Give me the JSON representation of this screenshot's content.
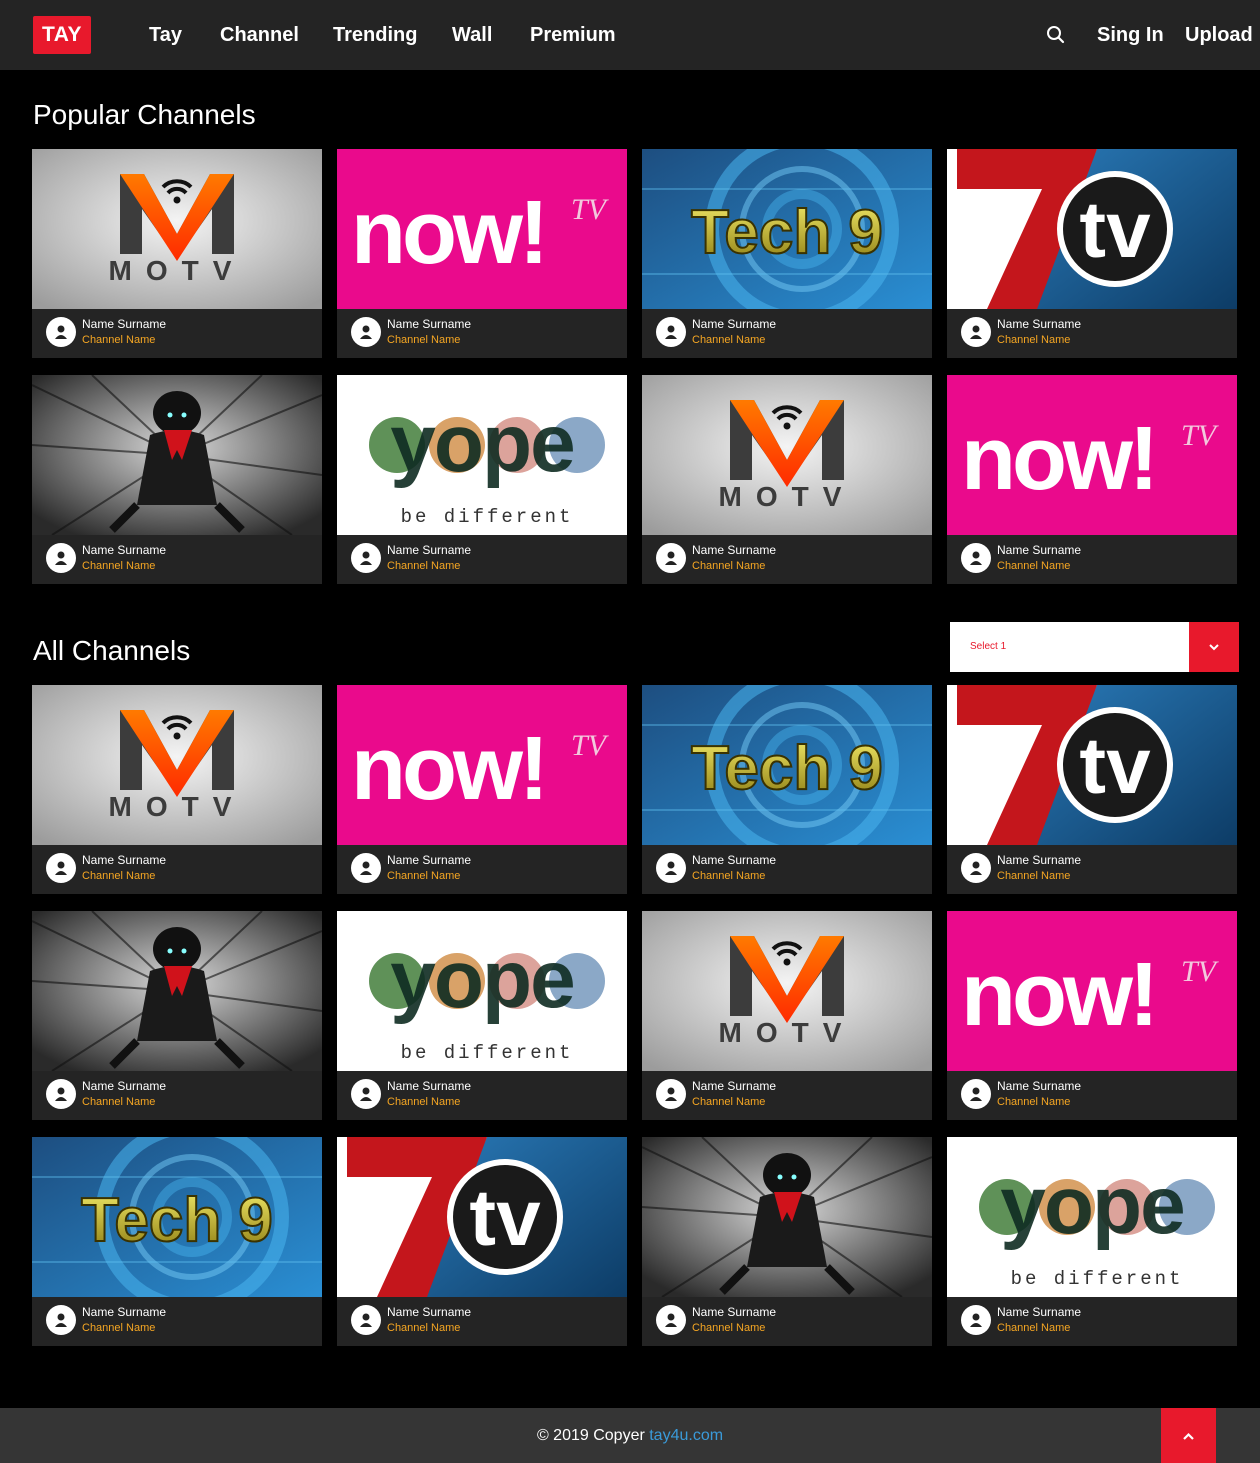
{
  "header": {
    "logo": "TAY",
    "nav": [
      "Tay",
      "Channel",
      "Trending",
      "Wall",
      "Premium"
    ],
    "sign_in": "Sing In",
    "upload": "Upload",
    "search_icon": "search-icon"
  },
  "popular": {
    "title": "Popular Channels",
    "cards": [
      {
        "thumb": "motv",
        "name": "Name Surname",
        "channel": "Channel Name"
      },
      {
        "thumb": "now",
        "name": "Name Surname",
        "channel": "Channel Name"
      },
      {
        "thumb": "tech9",
        "name": "Name Surname",
        "channel": "Channel Name"
      },
      {
        "thumb": "7tv",
        "name": "Name Surname",
        "channel": "Channel Name"
      },
      {
        "thumb": "anime",
        "name": "Name Surname",
        "channel": "Channel Name"
      },
      {
        "thumb": "yope",
        "name": "Name Surname",
        "channel": "Channel Name"
      },
      {
        "thumb": "motv",
        "name": "Name Surname",
        "channel": "Channel Name"
      },
      {
        "thumb": "now",
        "name": "Name Surname",
        "channel": "Channel Name"
      }
    ]
  },
  "all": {
    "title": "All Channels",
    "select": {
      "value": "Select 1"
    },
    "cards": [
      {
        "thumb": "motv",
        "name": "Name Surname",
        "channel": "Channel Name"
      },
      {
        "thumb": "now",
        "name": "Name Surname",
        "channel": "Channel Name"
      },
      {
        "thumb": "tech9",
        "name": "Name Surname",
        "channel": "Channel Name"
      },
      {
        "thumb": "7tv",
        "name": "Name Surname",
        "channel": "Channel Name"
      },
      {
        "thumb": "anime",
        "name": "Name Surname",
        "channel": "Channel Name"
      },
      {
        "thumb": "yope",
        "name": "Name Surname",
        "channel": "Channel Name"
      },
      {
        "thumb": "motv",
        "name": "Name Surname",
        "channel": "Channel Name"
      },
      {
        "thumb": "now",
        "name": "Name Surname",
        "channel": "Channel Name"
      },
      {
        "thumb": "tech9",
        "name": "Name Surname",
        "channel": "Channel Name"
      },
      {
        "thumb": "7tv",
        "name": "Name Surname",
        "channel": "Channel Name"
      },
      {
        "thumb": "anime",
        "name": "Name Surname",
        "channel": "Channel Name"
      },
      {
        "thumb": "yope",
        "name": "Name Surname",
        "channel": "Channel Name"
      }
    ]
  },
  "logos": {
    "motv_text": "MOTV",
    "now_text": "now!",
    "now_tv": "TV",
    "tech_text": "Tech 9",
    "tv7_num": "7",
    "tv7_text": "tv",
    "yope_text": "yope",
    "yope_tag": "be different"
  },
  "footer": {
    "copyright": "© 2019 Copyer ",
    "link": "tay4u.com"
  },
  "colors": {
    "accent": "#e8192c",
    "channel": "#f5a623",
    "link": "#3a9ad9"
  }
}
